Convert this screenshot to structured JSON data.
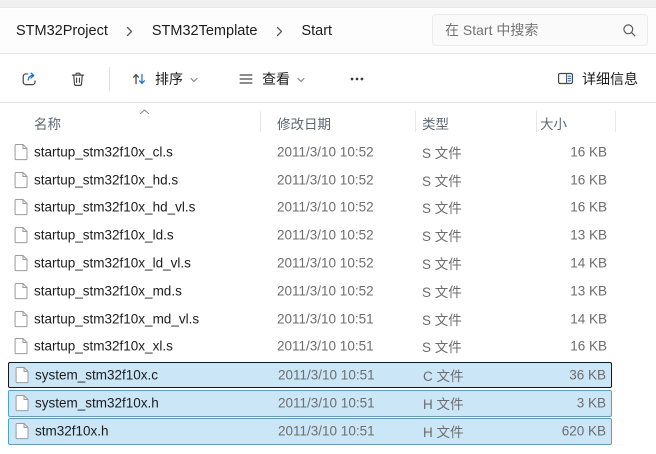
{
  "breadcrumb": {
    "items": [
      "STM32Project",
      "STM32Template",
      "Start"
    ]
  },
  "search": {
    "placeholder": "在 Start 中搜索",
    "icon": "search-icon"
  },
  "toolbar": {
    "share_icon": "share-icon",
    "trash_icon": "trash-icon",
    "sort_icon": "sort-arrows-icon",
    "sort_label": "排序",
    "view_icon": "view-list-icon",
    "view_label": "查看",
    "more_icon": "more-ellipsis-icon",
    "details_icon": "details-pane-icon",
    "details_label": "详细信息"
  },
  "columns": {
    "name": "名称",
    "date": "修改日期",
    "type": "类型",
    "size": "大小",
    "sort_indicator": "chevron-up-icon"
  },
  "files": [
    {
      "name": "startup_stm32f10x_cl.s",
      "date": "2011/3/10 10:52",
      "type": "S 文件",
      "size": "16 KB",
      "selected": false,
      "focused": false
    },
    {
      "name": "startup_stm32f10x_hd.s",
      "date": "2011/3/10 10:52",
      "type": "S 文件",
      "size": "16 KB",
      "selected": false,
      "focused": false
    },
    {
      "name": "startup_stm32f10x_hd_vl.s",
      "date": "2011/3/10 10:52",
      "type": "S 文件",
      "size": "16 KB",
      "selected": false,
      "focused": false
    },
    {
      "name": "startup_stm32f10x_ld.s",
      "date": "2011/3/10 10:52",
      "type": "S 文件",
      "size": "13 KB",
      "selected": false,
      "focused": false
    },
    {
      "name": "startup_stm32f10x_ld_vl.s",
      "date": "2011/3/10 10:52",
      "type": "S 文件",
      "size": "14 KB",
      "selected": false,
      "focused": false
    },
    {
      "name": "startup_stm32f10x_md.s",
      "date": "2011/3/10 10:52",
      "type": "S 文件",
      "size": "13 KB",
      "selected": false,
      "focused": false
    },
    {
      "name": "startup_stm32f10x_md_vl.s",
      "date": "2011/3/10 10:51",
      "type": "S 文件",
      "size": "14 KB",
      "selected": false,
      "focused": false
    },
    {
      "name": "startup_stm32f10x_xl.s",
      "date": "2011/3/10 10:51",
      "type": "S 文件",
      "size": "16 KB",
      "selected": false,
      "focused": false
    },
    {
      "name": "system_stm32f10x.c",
      "date": "2011/3/10 10:51",
      "type": "C 文件",
      "size": "36 KB",
      "selected": true,
      "focused": true
    },
    {
      "name": "system_stm32f10x.h",
      "date": "2011/3/10 10:51",
      "type": "H 文件",
      "size": "3 KB",
      "selected": true,
      "focused": false
    },
    {
      "name": "stm32f10x.h",
      "date": "2011/3/10 10:51",
      "type": "H 文件",
      "size": "620 KB",
      "selected": true,
      "focused": false
    }
  ],
  "colors": {
    "accent": "#1673d2",
    "selection_bg": "#cbe6f7",
    "selection_border": "#4aa3d8",
    "focus_border": "#14171c",
    "icon_gray": "#474747"
  }
}
